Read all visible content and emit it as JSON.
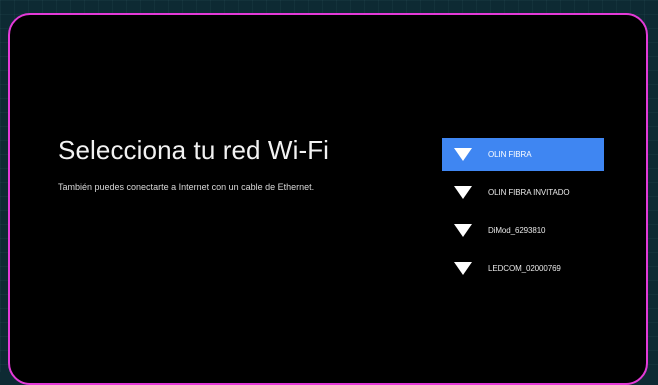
{
  "setup": {
    "title": "Selecciona tu red Wi-Fi",
    "subtitle": "También puedes conectarte a Internet con un cable de Ethernet."
  },
  "networks": [
    {
      "name": "OLIN FIBRA",
      "icon": "wifi-full-icon",
      "selected": true
    },
    {
      "name": "OLIN FIBRA INVITADO",
      "icon": "wifi-full-icon",
      "selected": false
    },
    {
      "name": "DiMod_6293810",
      "icon": "wifi-full-icon",
      "selected": false
    },
    {
      "name": "LEDCOM_02000769",
      "icon": "wifi-full-icon",
      "selected": false
    }
  ],
  "colors": {
    "frame_border": "#e43ad8",
    "selected_highlight": "#3f86f2",
    "screen_background": "#000000",
    "outer_background": "#0d2a33"
  }
}
